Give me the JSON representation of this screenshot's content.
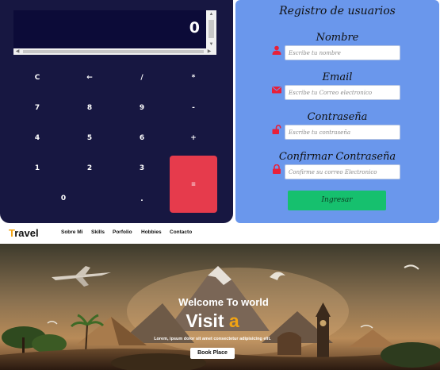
{
  "calculator": {
    "display": "0",
    "keys": {
      "clear": "C",
      "backspace": "←",
      "divide": "/",
      "multiply": "*",
      "seven": "7",
      "eight": "8",
      "nine": "9",
      "minus": "-",
      "four": "4",
      "five": "5",
      "six": "6",
      "plus": "+",
      "one": "1",
      "two": "2",
      "three": "3",
      "zero": "0",
      "decimal": ".",
      "equals": "="
    },
    "colors": {
      "background": "#171741",
      "display": "#0c0b38",
      "equals": "#e63b4c"
    }
  },
  "registro": {
    "title": "Registro de usuarios",
    "fields": [
      {
        "label": "Nombre",
        "placeholder": "Escribe tu nombre",
        "icon": "user-icon"
      },
      {
        "label": "Email",
        "placeholder": "Escribe tu Correo electronico",
        "icon": "envelope-icon"
      },
      {
        "label": "Contraseña",
        "placeholder": "Escribe tu contraseña",
        "icon": "unlock-icon"
      },
      {
        "label": "Confirmar Contraseña",
        "placeholder": "Confirme su correo Electronico",
        "icon": "lock-icon"
      }
    ],
    "submit": "Ingresar",
    "colors": {
      "background": "#6a97ec",
      "button": "#16c06e",
      "icon": "#e8203a"
    }
  },
  "travel": {
    "brand_first": "T",
    "brand_rest": "ravel",
    "nav": [
      "Sobre Mi",
      "Skills",
      "Porfolio",
      "Hobbies",
      "Contacto"
    ],
    "hero": {
      "subtitle": "Welcome To world",
      "title_main": "Visit ",
      "title_accent": "a",
      "description": "Lorem, ipsum dolor sit amet consectetur adipisicing elit.",
      "button": "Book Place"
    },
    "colors": {
      "accent": "#f2a413"
    }
  }
}
